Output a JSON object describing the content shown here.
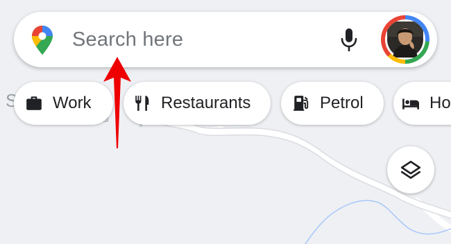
{
  "search": {
    "placeholder": "Search here"
  },
  "chips": [
    {
      "label": "Work",
      "icon": "briefcase-icon"
    },
    {
      "label": "Restaurants",
      "icon": "cutlery-icon"
    },
    {
      "label": "Petrol",
      "icon": "fuel-pump-icon"
    },
    {
      "label": "Ho",
      "icon": "bed-icon"
    }
  ],
  "map": {
    "edge_label": "S"
  },
  "colors": {
    "map_background": "#eef0f3",
    "annotation_arrow": "#ee0000",
    "google_blue": "#4285f4",
    "google_red": "#ea4335",
    "google_yellow": "#fbbc05",
    "google_green": "#34a853"
  }
}
